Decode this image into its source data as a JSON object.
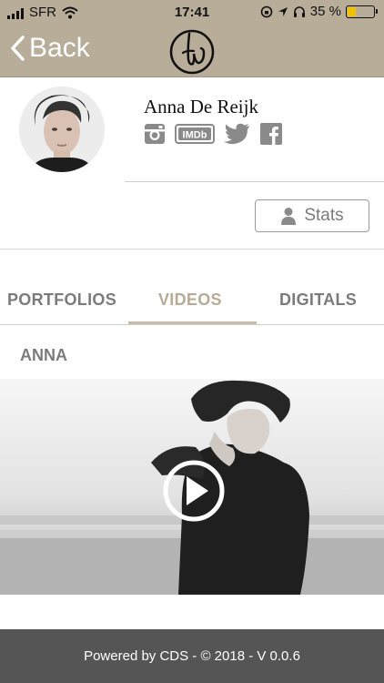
{
  "status_bar": {
    "carrier": "SFR",
    "time": "17:41",
    "battery_percent": "35 %",
    "battery_level": 0.35
  },
  "nav": {
    "back_label": "Back",
    "logo_icon": "brand-w-logo"
  },
  "profile": {
    "name": "Anna De Reijk",
    "social_icons": [
      "instagram-icon",
      "imdb-icon",
      "twitter-icon",
      "facebook-icon"
    ],
    "imdb_text": "IMDb",
    "stats_label": "Stats"
  },
  "tabs": [
    {
      "label": "PORTFOLIOS",
      "active": false
    },
    {
      "label": "VIDEOS",
      "active": true
    },
    {
      "label": "DIGITALS",
      "active": false
    }
  ],
  "videos": {
    "section_title": "ANNA",
    "play_icon": "play-icon"
  },
  "footer": {
    "text": "Powered by CDS - © 2018 - V 0.0.6"
  },
  "colors": {
    "header_bg": "#b8ad99",
    "accent": "#c8bca6",
    "tab_inactive": "#7b7b7b",
    "footer_bg": "#555555"
  }
}
